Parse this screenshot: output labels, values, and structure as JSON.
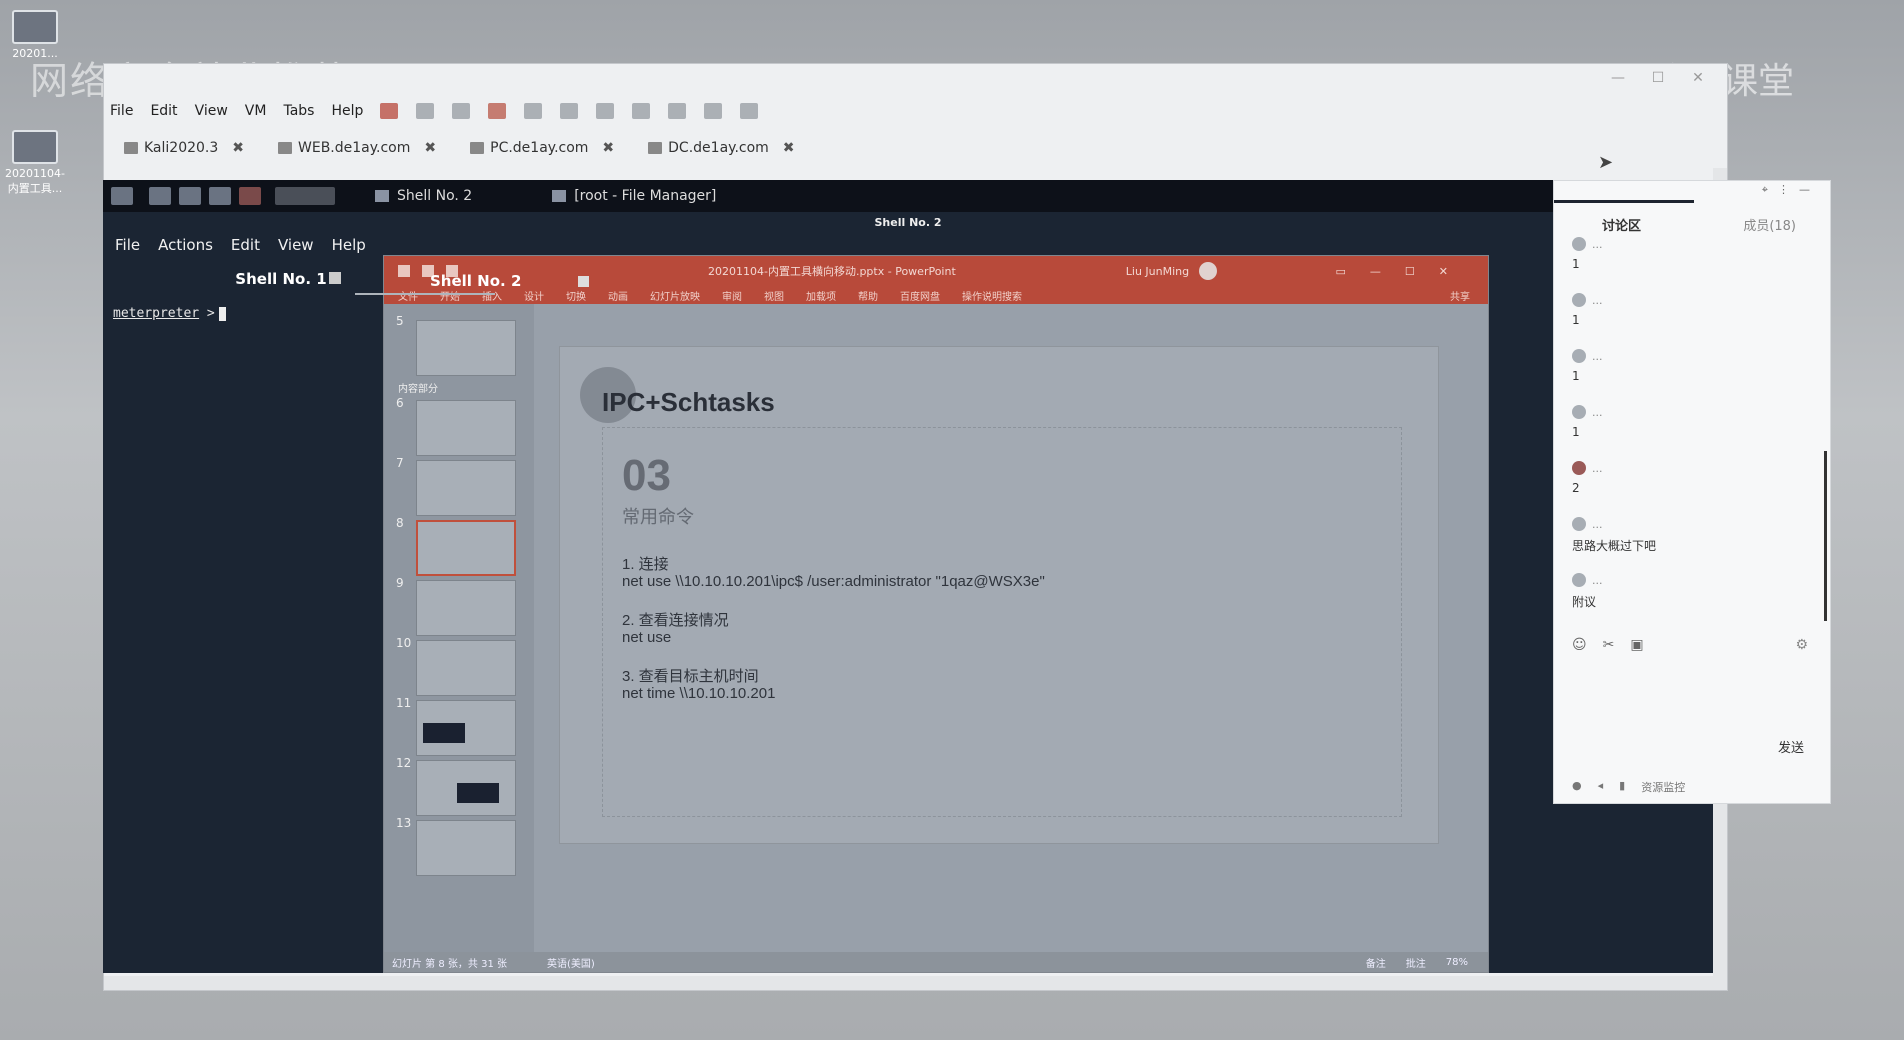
{
  "desktop": {
    "watermark_left": "网络安全就业推荐",
    "watermark_right": "腾讯课堂",
    "icons": [
      {
        "label": "20201..."
      },
      {
        "label": "20201104-内置工具..."
      }
    ]
  },
  "vm": {
    "menu": [
      "File",
      "Edit",
      "View",
      "VM",
      "Tabs",
      "Help"
    ],
    "tabs": [
      {
        "label": "Kali2020.3"
      },
      {
        "label": "WEB.de1ay.com"
      },
      {
        "label": "PC.de1ay.com"
      },
      {
        "label": "DC.de1ay.com"
      }
    ],
    "close_glyph": "✖"
  },
  "kali": {
    "taskbar": {
      "task1": "Shell No. 2",
      "task2": "[root - File Manager]"
    },
    "window_title": "Shell No. 2",
    "terminal": {
      "menu": [
        "File",
        "Actions",
        "Edit",
        "View",
        "Help"
      ],
      "tab1": "Shell No. 1",
      "tab2": "Shell No. 2",
      "prompt_word": "meterpreter",
      "prompt_sym": " >"
    }
  },
  "ppt": {
    "title_bar": "20201104-内置工具横向移动.pptx  -  PowerPoint",
    "user": "Liu JunMing",
    "ribbon": [
      "文件",
      "开始",
      "插入",
      "设计",
      "切换",
      "动画",
      "幻灯片放映",
      "审阅",
      "视图",
      "加载项",
      "帮助",
      "百度网盘",
      "操作说明搜索"
    ],
    "share": "共享",
    "sections": [
      "内容部分"
    ],
    "thumb_numbers": [
      "5",
      "6",
      "7",
      "8",
      "9",
      "10",
      "11",
      "12",
      "13"
    ],
    "slide": {
      "title": "IPC+Schtasks",
      "number": "03",
      "subtitle": "常用命令",
      "lines": [
        "1. 连接",
        "net use \\\\10.10.10.201\\ipc$ /user:administrator \"1qaz@WSX3e\"",
        "2. 查看连接情况",
        "net use",
        "3. 查看目标主机时间",
        "net time \\\\10.10.10.201"
      ]
    },
    "status": {
      "slide_info": "幻灯片 第 8 张，共 31 张",
      "lang": "英语(美国)",
      "notes": "备注",
      "comments": "批注",
      "zoom": "78%"
    }
  },
  "chat": {
    "tab_discuss": "讨论区",
    "tab_members": "成员(18)",
    "messages": [
      {
        "name": "...",
        "text": "1"
      },
      {
        "name": "...",
        "text": "1"
      },
      {
        "name": "...",
        "text": "1"
      },
      {
        "name": "...",
        "text": "1"
      },
      {
        "name": "...",
        "text": "2"
      },
      {
        "name": "...",
        "text": "思路大概过下吧"
      },
      {
        "name": "...",
        "text": "附议"
      }
    ],
    "send": "发送",
    "resource_monitor": "资源监控"
  }
}
